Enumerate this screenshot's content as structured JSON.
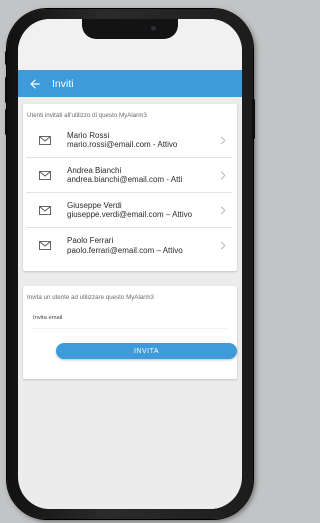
{
  "header": {
    "title": "Inviti",
    "back_icon": "arrow-left-icon"
  },
  "users_card": {
    "title": "Utenti invitati all'utilizzo di questo MyAlarm3",
    "items": [
      {
        "name": "Mario Rossi",
        "detail": "mario.rossi@email.com - Attivo"
      },
      {
        "name": "Andrea Bianchi",
        "detail": "andrea.bianchi@email.com - Atti"
      },
      {
        "name": "Giuseppe Verdi",
        "detail": "giuseppe.verdi@email.com – Attivo"
      },
      {
        "name": "Paolo Ferrari",
        "detail": "paolo.ferrari@email.com – Attivo"
      }
    ]
  },
  "invite_card": {
    "title": "Invita un utente ad utilizzare questo MyAlarm3",
    "email_label": "Invita email",
    "button_label": "INVITA"
  },
  "colors": {
    "accent": "#3d9bdc",
    "background": "#ececec",
    "frame": "#1a1a1a"
  }
}
